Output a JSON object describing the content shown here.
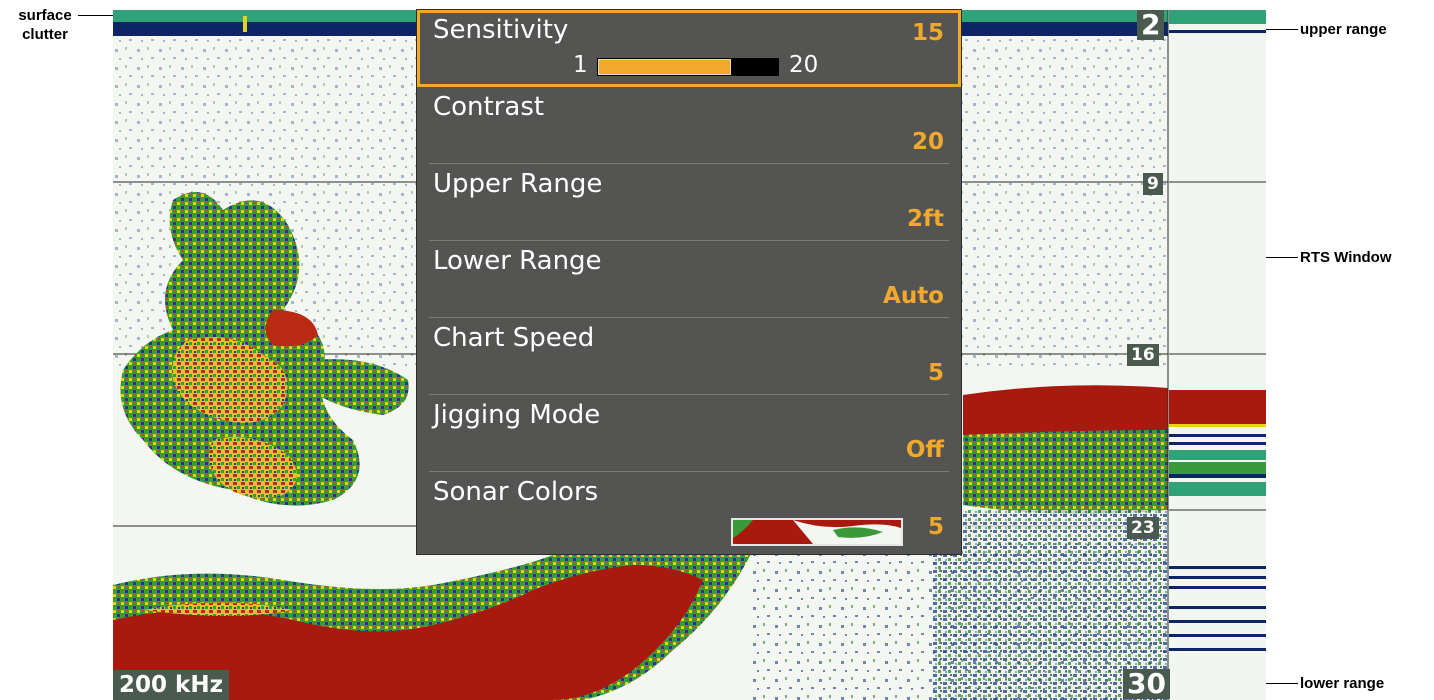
{
  "callouts": {
    "surface_clutter": "surface clutter",
    "upper_range": "upper range",
    "rts_window": "RTS Window",
    "lower_range": "lower range"
  },
  "depth_markers": {
    "top": "2",
    "d9": "9",
    "d16": "16",
    "d23": "23",
    "bottom": "30"
  },
  "frequency": "200 kHz",
  "menu": {
    "sensitivity": {
      "label": "Sensitivity",
      "value": "15",
      "min": "1",
      "max": "20",
      "level_fraction": 0.737
    },
    "contrast": {
      "label": "Contrast",
      "value": "20"
    },
    "upper_range": {
      "label": "Upper Range",
      "value": "2ft"
    },
    "lower_range": {
      "label": "Lower Range",
      "value": "Auto"
    },
    "chart_speed": {
      "label": "Chart Speed",
      "value": "5"
    },
    "jigging_mode": {
      "label": "Jigging Mode",
      "value": "Off"
    },
    "sonar_colors": {
      "label": "Sonar Colors",
      "value": "5"
    }
  },
  "colors": {
    "accent": "#f2a92b",
    "menu_bg": "#545553",
    "bottom_return": "#b01b12",
    "surface": "#0e2a6b"
  }
}
